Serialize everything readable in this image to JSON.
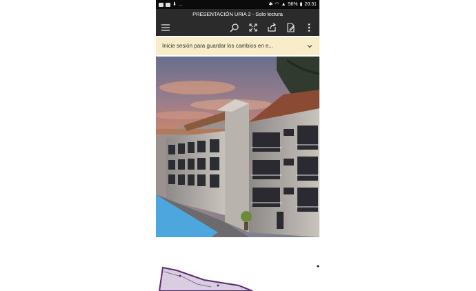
{
  "status_bar": {
    "left_icons": [
      "image-icon",
      "notification-icon",
      "download-icon"
    ],
    "ellipsis": "...",
    "battery_percent": "56%",
    "time": "20:31"
  },
  "document": {
    "title": "PRESENTACIÓN URIA 2 - Solo lectura"
  },
  "toolbar": {
    "icons": [
      "menu-icon",
      "search-icon",
      "fullscreen-icon",
      "share-icon",
      "edit-icon",
      "more-icon"
    ]
  },
  "notice": {
    "text": "Inicie sesión para guardar los cambios en e..."
  },
  "colors": {
    "status_bar": "#0b0b0b",
    "toolbar": "#2b2b2b",
    "notice_bg": "#f8edc8",
    "pool": "#4ea6de",
    "plan_outline": "#5a2b6e"
  }
}
